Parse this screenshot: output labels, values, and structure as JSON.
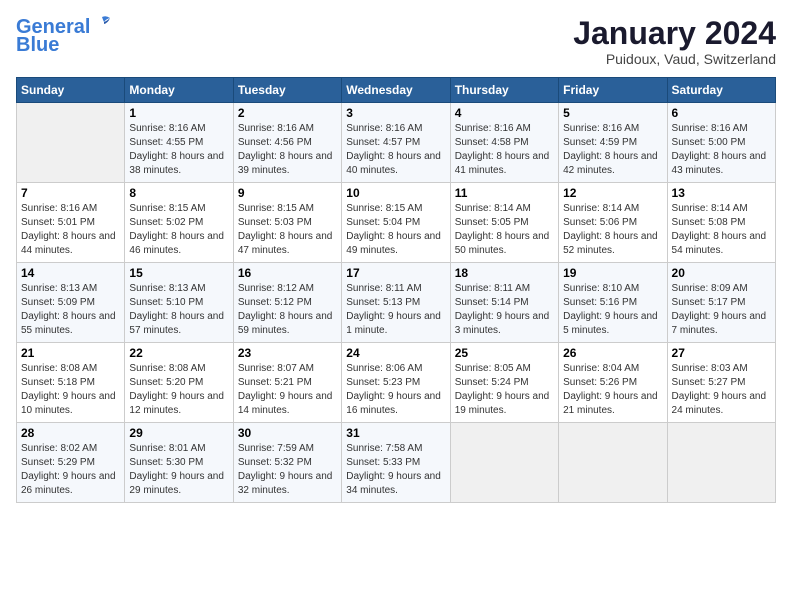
{
  "header": {
    "logo_line1": "General",
    "logo_line2": "Blue",
    "month_title": "January 2024",
    "location": "Puidoux, Vaud, Switzerland"
  },
  "weekdays": [
    "Sunday",
    "Monday",
    "Tuesday",
    "Wednesday",
    "Thursday",
    "Friday",
    "Saturday"
  ],
  "weeks": [
    [
      {
        "day": "",
        "sunrise": "",
        "sunset": "",
        "daylight": ""
      },
      {
        "day": "1",
        "sunrise": "Sunrise: 8:16 AM",
        "sunset": "Sunset: 4:55 PM",
        "daylight": "Daylight: 8 hours and 38 minutes."
      },
      {
        "day": "2",
        "sunrise": "Sunrise: 8:16 AM",
        "sunset": "Sunset: 4:56 PM",
        "daylight": "Daylight: 8 hours and 39 minutes."
      },
      {
        "day": "3",
        "sunrise": "Sunrise: 8:16 AM",
        "sunset": "Sunset: 4:57 PM",
        "daylight": "Daylight: 8 hours and 40 minutes."
      },
      {
        "day": "4",
        "sunrise": "Sunrise: 8:16 AM",
        "sunset": "Sunset: 4:58 PM",
        "daylight": "Daylight: 8 hours and 41 minutes."
      },
      {
        "day": "5",
        "sunrise": "Sunrise: 8:16 AM",
        "sunset": "Sunset: 4:59 PM",
        "daylight": "Daylight: 8 hours and 42 minutes."
      },
      {
        "day": "6",
        "sunrise": "Sunrise: 8:16 AM",
        "sunset": "Sunset: 5:00 PM",
        "daylight": "Daylight: 8 hours and 43 minutes."
      }
    ],
    [
      {
        "day": "7",
        "sunrise": "Sunrise: 8:16 AM",
        "sunset": "Sunset: 5:01 PM",
        "daylight": "Daylight: 8 hours and 44 minutes."
      },
      {
        "day": "8",
        "sunrise": "Sunrise: 8:15 AM",
        "sunset": "Sunset: 5:02 PM",
        "daylight": "Daylight: 8 hours and 46 minutes."
      },
      {
        "day": "9",
        "sunrise": "Sunrise: 8:15 AM",
        "sunset": "Sunset: 5:03 PM",
        "daylight": "Daylight: 8 hours and 47 minutes."
      },
      {
        "day": "10",
        "sunrise": "Sunrise: 8:15 AM",
        "sunset": "Sunset: 5:04 PM",
        "daylight": "Daylight: 8 hours and 49 minutes."
      },
      {
        "day": "11",
        "sunrise": "Sunrise: 8:14 AM",
        "sunset": "Sunset: 5:05 PM",
        "daylight": "Daylight: 8 hours and 50 minutes."
      },
      {
        "day": "12",
        "sunrise": "Sunrise: 8:14 AM",
        "sunset": "Sunset: 5:06 PM",
        "daylight": "Daylight: 8 hours and 52 minutes."
      },
      {
        "day": "13",
        "sunrise": "Sunrise: 8:14 AM",
        "sunset": "Sunset: 5:08 PM",
        "daylight": "Daylight: 8 hours and 54 minutes."
      }
    ],
    [
      {
        "day": "14",
        "sunrise": "Sunrise: 8:13 AM",
        "sunset": "Sunset: 5:09 PM",
        "daylight": "Daylight: 8 hours and 55 minutes."
      },
      {
        "day": "15",
        "sunrise": "Sunrise: 8:13 AM",
        "sunset": "Sunset: 5:10 PM",
        "daylight": "Daylight: 8 hours and 57 minutes."
      },
      {
        "day": "16",
        "sunrise": "Sunrise: 8:12 AM",
        "sunset": "Sunset: 5:12 PM",
        "daylight": "Daylight: 8 hours and 59 minutes."
      },
      {
        "day": "17",
        "sunrise": "Sunrise: 8:11 AM",
        "sunset": "Sunset: 5:13 PM",
        "daylight": "Daylight: 9 hours and 1 minute."
      },
      {
        "day": "18",
        "sunrise": "Sunrise: 8:11 AM",
        "sunset": "Sunset: 5:14 PM",
        "daylight": "Daylight: 9 hours and 3 minutes."
      },
      {
        "day": "19",
        "sunrise": "Sunrise: 8:10 AM",
        "sunset": "Sunset: 5:16 PM",
        "daylight": "Daylight: 9 hours and 5 minutes."
      },
      {
        "day": "20",
        "sunrise": "Sunrise: 8:09 AM",
        "sunset": "Sunset: 5:17 PM",
        "daylight": "Daylight: 9 hours and 7 minutes."
      }
    ],
    [
      {
        "day": "21",
        "sunrise": "Sunrise: 8:08 AM",
        "sunset": "Sunset: 5:18 PM",
        "daylight": "Daylight: 9 hours and 10 minutes."
      },
      {
        "day": "22",
        "sunrise": "Sunrise: 8:08 AM",
        "sunset": "Sunset: 5:20 PM",
        "daylight": "Daylight: 9 hours and 12 minutes."
      },
      {
        "day": "23",
        "sunrise": "Sunrise: 8:07 AM",
        "sunset": "Sunset: 5:21 PM",
        "daylight": "Daylight: 9 hours and 14 minutes."
      },
      {
        "day": "24",
        "sunrise": "Sunrise: 8:06 AM",
        "sunset": "Sunset: 5:23 PM",
        "daylight": "Daylight: 9 hours and 16 minutes."
      },
      {
        "day": "25",
        "sunrise": "Sunrise: 8:05 AM",
        "sunset": "Sunset: 5:24 PM",
        "daylight": "Daylight: 9 hours and 19 minutes."
      },
      {
        "day": "26",
        "sunrise": "Sunrise: 8:04 AM",
        "sunset": "Sunset: 5:26 PM",
        "daylight": "Daylight: 9 hours and 21 minutes."
      },
      {
        "day": "27",
        "sunrise": "Sunrise: 8:03 AM",
        "sunset": "Sunset: 5:27 PM",
        "daylight": "Daylight: 9 hours and 24 minutes."
      }
    ],
    [
      {
        "day": "28",
        "sunrise": "Sunrise: 8:02 AM",
        "sunset": "Sunset: 5:29 PM",
        "daylight": "Daylight: 9 hours and 26 minutes."
      },
      {
        "day": "29",
        "sunrise": "Sunrise: 8:01 AM",
        "sunset": "Sunset: 5:30 PM",
        "daylight": "Daylight: 9 hours and 29 minutes."
      },
      {
        "day": "30",
        "sunrise": "Sunrise: 7:59 AM",
        "sunset": "Sunset: 5:32 PM",
        "daylight": "Daylight: 9 hours and 32 minutes."
      },
      {
        "day": "31",
        "sunrise": "Sunrise: 7:58 AM",
        "sunset": "Sunset: 5:33 PM",
        "daylight": "Daylight: 9 hours and 34 minutes."
      },
      {
        "day": "",
        "sunrise": "",
        "sunset": "",
        "daylight": ""
      },
      {
        "day": "",
        "sunrise": "",
        "sunset": "",
        "daylight": ""
      },
      {
        "day": "",
        "sunrise": "",
        "sunset": "",
        "daylight": ""
      }
    ]
  ]
}
